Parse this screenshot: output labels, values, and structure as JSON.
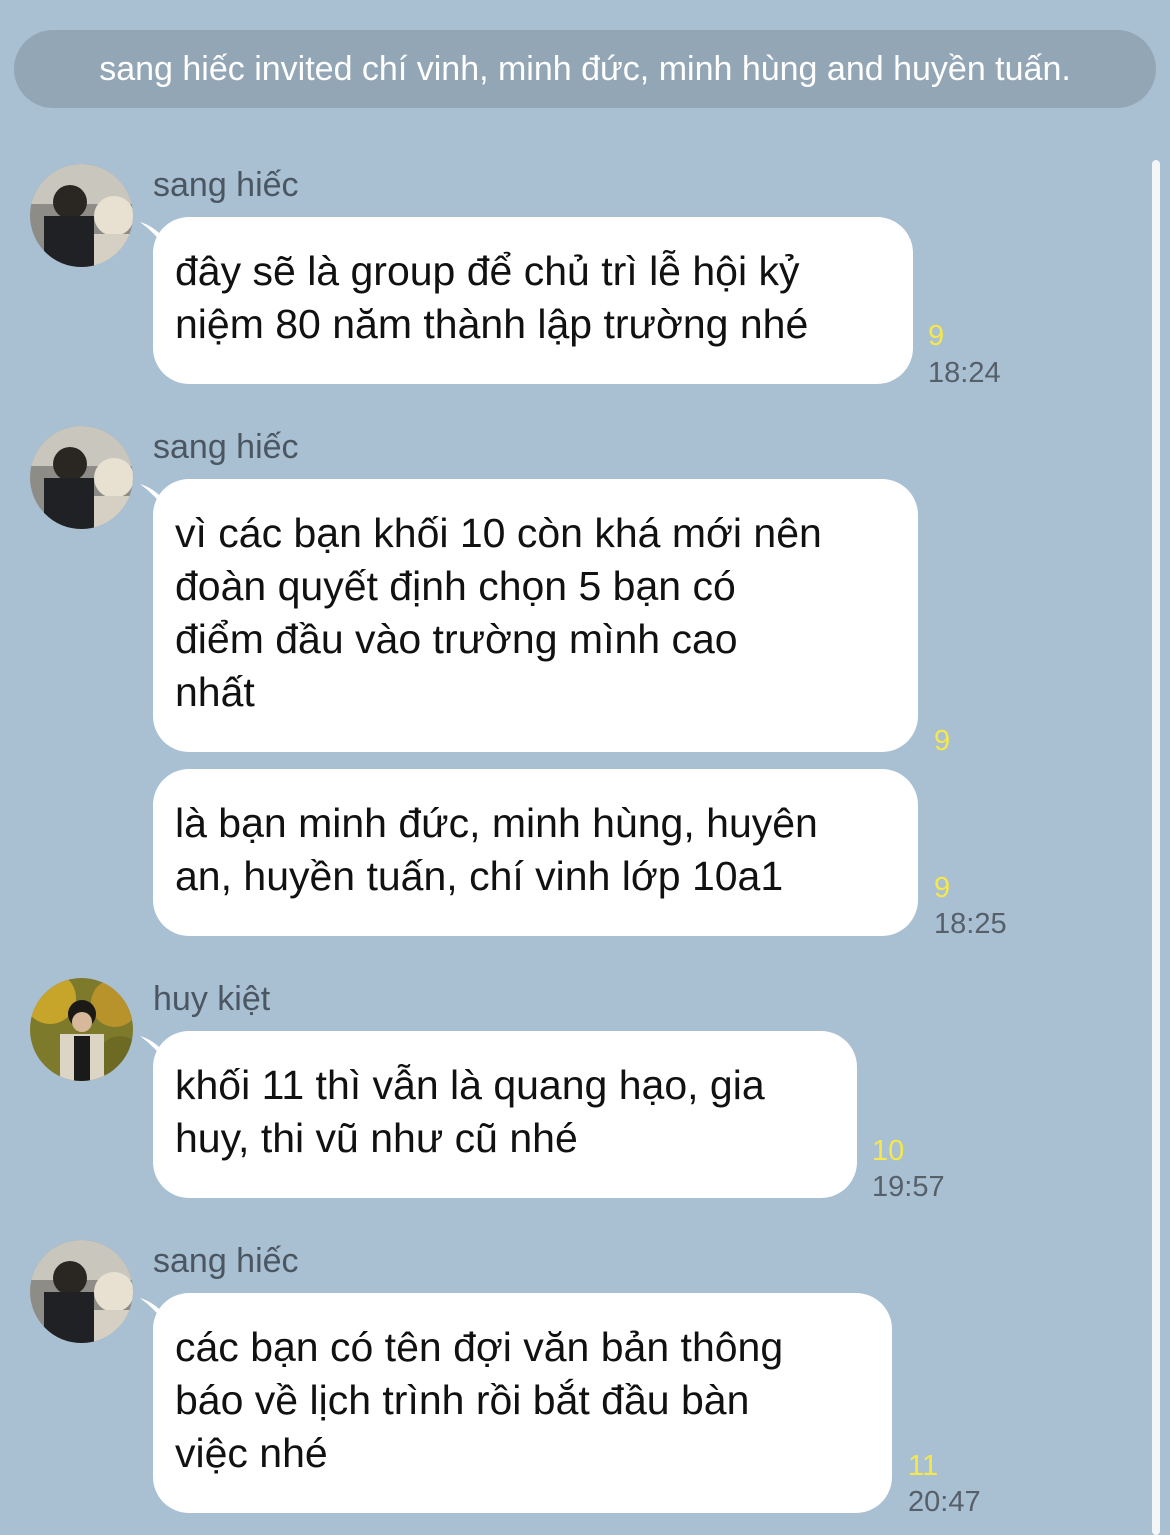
{
  "system_message": "sang hiếc invited chí vinh, minh đức, minh hùng and huyền tuấn.",
  "messages": [
    {
      "sender": "sang hiếc",
      "avatar_icon": "sang-hiec-avatar",
      "text": "đây sẽ là group để chủ trì lễ hội kỷ\nniệm 80 năm thành lập trường nhé",
      "read_count": "9",
      "time": "18:24"
    },
    {
      "sender": "sang hiếc",
      "avatar_icon": "sang-hiec-avatar",
      "text": "vì các bạn khối 10 còn khá mới nên\nđoàn quyết định chọn 5 bạn có\nđiểm đầu vào trường mình cao\nnhất",
      "read_count": "9",
      "time": ""
    },
    {
      "sender": "",
      "avatar_icon": "",
      "text": "là bạn minh đức, minh hùng, huyên\nan, huyền tuấn, chí vinh lớp 10a1",
      "read_count": "9",
      "time": "18:25"
    },
    {
      "sender": "huy kiệt",
      "avatar_icon": "huy-kiet-avatar",
      "text": "khối 11 thì vẫn là quang hạo, gia\nhuy, thi vũ như cũ nhé",
      "read_count": "10",
      "time": "19:57"
    },
    {
      "sender": "sang hiếc",
      "avatar_icon": "sang-hiec-avatar",
      "text": "các bạn có tên đợi văn bản thông\nbáo về lịch trình rồi bắt đầu bàn\nviệc nhé",
      "read_count": "11",
      "time": "20:47"
    }
  ],
  "colors": {
    "background": "#a9bfd2",
    "system_pill": "#93a6b6",
    "bubble": "#ffffff",
    "read_count": "#f6e84a",
    "time": "#56606a"
  }
}
